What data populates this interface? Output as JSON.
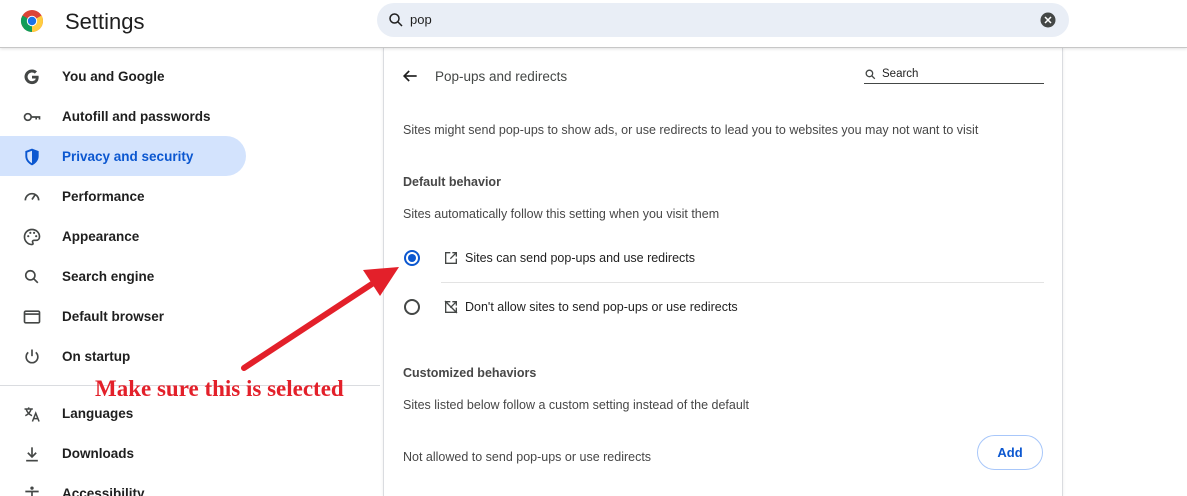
{
  "header": {
    "app_title": "Settings",
    "search_value": "pop"
  },
  "sidebar": {
    "items": [
      {
        "label": "You and Google",
        "icon": "google-g-icon",
        "active": false
      },
      {
        "label": "Autofill and passwords",
        "icon": "key-icon",
        "active": false
      },
      {
        "label": "Privacy and security",
        "icon": "shield-icon",
        "active": true
      },
      {
        "label": "Performance",
        "icon": "speedometer-icon",
        "active": false
      },
      {
        "label": "Appearance",
        "icon": "palette-icon",
        "active": false
      },
      {
        "label": "Search engine",
        "icon": "search-icon",
        "active": false
      },
      {
        "label": "Default browser",
        "icon": "browser-window-icon",
        "active": false
      },
      {
        "label": "On startup",
        "icon": "power-icon",
        "active": false
      },
      {
        "label": "Languages",
        "icon": "translate-icon",
        "active": false
      },
      {
        "label": "Downloads",
        "icon": "download-icon",
        "active": false
      },
      {
        "label": "Accessibility",
        "icon": "accessibility-icon",
        "active": false
      }
    ]
  },
  "main": {
    "page_title": "Pop-ups and redirects",
    "search_placeholder": "Search",
    "description": "Sites might send pop-ups to show ads, or use redirects to lead you to websites you may not want to visit",
    "default_behavior": {
      "heading": "Default behavior",
      "subtext": "Sites automatically follow this setting when you visit them",
      "options": [
        {
          "label": "Sites can send pop-ups and use redirects",
          "icon": "open-in-new-icon",
          "selected": true
        },
        {
          "label": "Don't allow sites to send pop-ups or use redirects",
          "icon": "blocked-popup-icon",
          "selected": false
        }
      ]
    },
    "customized": {
      "heading": "Customized behaviors",
      "subtext": "Sites listed below follow a custom setting instead of the default",
      "not_allowed_label": "Not allowed to send pop-ups or use redirects",
      "add_label": "Add"
    }
  },
  "annotation": {
    "text": "Make sure this is selected",
    "color": "#e3202a"
  },
  "colors": {
    "accent": "#0b57d0",
    "active_nav_bg": "#d3e3fd",
    "search_bg": "#e9eef6"
  }
}
